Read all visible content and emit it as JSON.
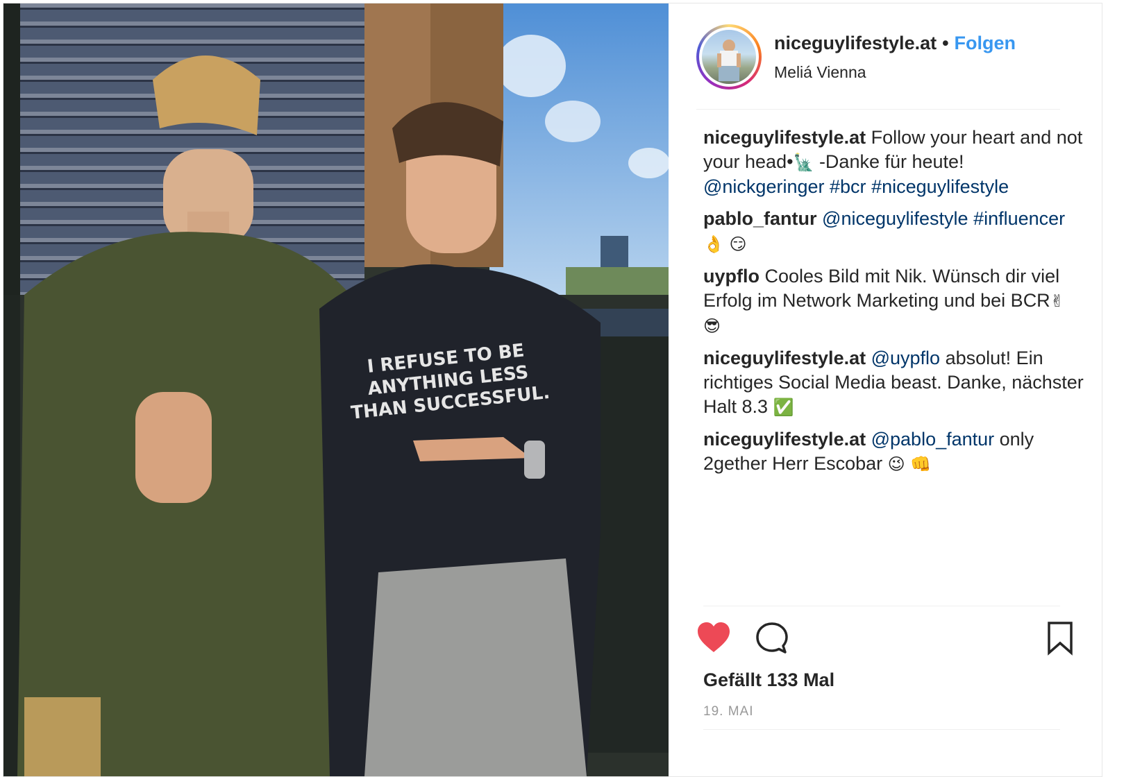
{
  "header": {
    "username": "niceguylifestyle.at",
    "separator": "•",
    "follow_label": "Folgen",
    "location": "Meliá Vienna"
  },
  "photo": {
    "shirt_text_line1": "I REFUSE TO BE",
    "shirt_text_line2": "ANYTHING LESS",
    "shirt_text_line3": "THAN SUCCESSFUL."
  },
  "comments": [
    {
      "user": "niceguylifestyle.at",
      "segments": [
        {
          "text": " Follow your heart and not your head•",
          "type": "text"
        },
        {
          "text": "🗽",
          "type": "emoji"
        },
        {
          "text": " -Danke für heute! ",
          "type": "text"
        },
        {
          "text": "@nickgeringer",
          "type": "tag"
        },
        {
          "text": " ",
          "type": "text"
        },
        {
          "text": "#bcr",
          "type": "tag"
        },
        {
          "text": " ",
          "type": "text"
        },
        {
          "text": "#niceguylifestyle",
          "type": "tag"
        }
      ]
    },
    {
      "user": "pablo_fantur",
      "segments": [
        {
          "text": " ",
          "type": "text"
        },
        {
          "text": "@niceguylifestyle",
          "type": "tag"
        },
        {
          "text": " ",
          "type": "text"
        },
        {
          "text": "#influencer",
          "type": "tag"
        },
        {
          "text": " 👌 😏",
          "type": "emoji"
        }
      ]
    },
    {
      "user": "uypflo",
      "segments": [
        {
          "text": " Cooles Bild mit Nik. Wünsch dir viel Erfolg im Network Marketing und bei BCR",
          "type": "text"
        },
        {
          "text": "✌",
          "type": "emoji"
        },
        {
          "text": " 😎",
          "type": "emoji"
        }
      ]
    },
    {
      "user": "niceguylifestyle.at",
      "segments": [
        {
          "text": " ",
          "type": "text"
        },
        {
          "text": "@uypflo",
          "type": "tag"
        },
        {
          "text": " absolut! Ein richtiges Social Media beast. Danke, nächster Halt 8.3 ",
          "type": "text"
        },
        {
          "text": "✅",
          "type": "emoji"
        }
      ]
    },
    {
      "user": "niceguylifestyle.at",
      "segments": [
        {
          "text": " ",
          "type": "text"
        },
        {
          "text": "@pablo_fantur",
          "type": "tag"
        },
        {
          "text": " only 2gether Herr Escobar ",
          "type": "text"
        },
        {
          "text": "😉 👊",
          "type": "emoji"
        }
      ]
    }
  ],
  "actions": {
    "like_icon": "heart-filled-icon",
    "comment_icon": "speech-bubble-icon",
    "save_icon": "bookmark-icon"
  },
  "likes_text": "Gefällt 133 Mal",
  "date_text": "19. MAI",
  "colors": {
    "accent": "#3897f0",
    "heart": "#ed4956",
    "tag": "#003569",
    "muted": "#999999"
  }
}
